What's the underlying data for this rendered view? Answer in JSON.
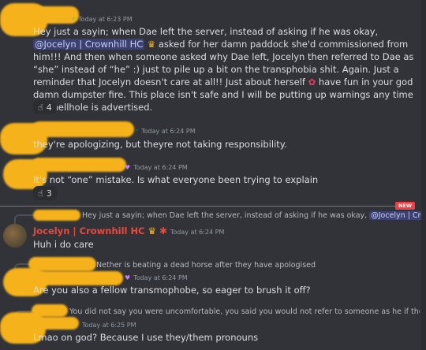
{
  "messages": {
    "m1": {
      "time": "Today at 6:23 PM",
      "text_a": "Hey just a sayin; when Dae left the server, instead of asking if he was okay,",
      "mention": "@Jocelyn | Crownhill HC",
      "text_b": "asked for her damn paddock she'd commissioned from him!!! And then when someone asked why Dae left, Jocelyn then referred to Dae as “she” instead of “he” :) just to pile up a bit on the transphobia shit. Again. Just a reminder that Jocelyn doesn't care at all!! Just about herself",
      "text_c": "have fun in your god damn dumpster fire. This place isn't safe and I will be putting up warnings any time this hellhole is advertised.",
      "reaction_count": "4"
    },
    "m2": {
      "time": "Today at 6:24 PM",
      "text": "they're apologizing, but theyre not taking responsibility."
    },
    "m3": {
      "time": "Today at 6:24 PM",
      "text": "It's not “one” mistake. Is what everyone been trying to explain",
      "reaction_count": "3"
    },
    "new_label": "NEW",
    "m4": {
      "reply": "Hey just a sayin; when Dae left the server, instead of asking if he was okay,",
      "reply_mention": "@Jocelyn | Crownhill H",
      "username": "Jocelyn | Crownhill HC",
      "time": "Today at 6:24 PM",
      "text": "Huh i do care"
    },
    "m5": {
      "reply": "Nether is beating a dead horse after they have apologised",
      "time": "Today at 6:24 PM",
      "text": "Are you also a fellow transmophobe, so eager to brush it off?"
    },
    "m6": {
      "reply": "You did not say you were uncomfortable, you said you would not refer to someone as he if they are clea",
      "time": "Today at 6:25 PM",
      "text": "Lmao on god? Because I use they/them pronouns"
    }
  },
  "colors": {
    "background": "#313338",
    "mention_bg": "#3c4270",
    "new_red": "#f23f43",
    "username": "#e84a3e",
    "censor": "#f5b21b"
  }
}
